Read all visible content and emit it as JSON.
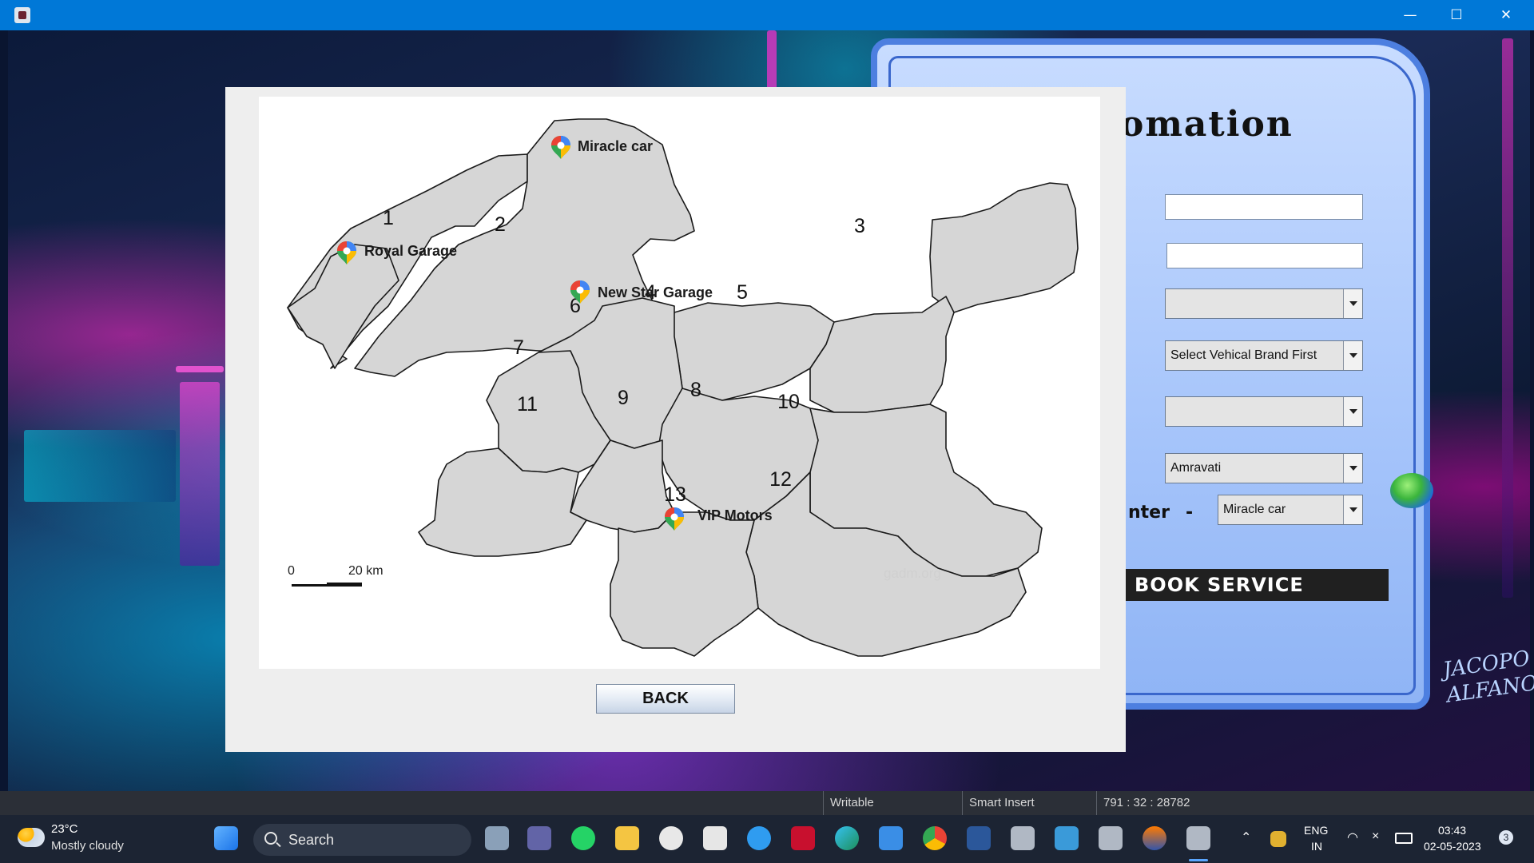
{
  "window": {
    "minimize_glyph": "—",
    "maximize_glyph": "☐",
    "close_glyph": "✕"
  },
  "background_app": {
    "title_fragment": "omation",
    "combo_brand": "Select Vehical Brand First",
    "combo_city": "Amravati",
    "center_label_fragment": "nter",
    "center_dash": "-",
    "combo_center": "Miracle car",
    "book_button": "BOOK SERVICE",
    "signature_line1": "JACOPO",
    "signature_line2": "ALFANO"
  },
  "map_dialog": {
    "districts": [
      {
        "number": "1"
      },
      {
        "number": "2"
      },
      {
        "number": "3"
      },
      {
        "number": "4"
      },
      {
        "number": "5"
      },
      {
        "number": "6"
      },
      {
        "number": "7"
      },
      {
        "number": "8"
      },
      {
        "number": "9"
      },
      {
        "number": "10"
      },
      {
        "number": "11"
      },
      {
        "number": "12"
      },
      {
        "number": "13"
      }
    ],
    "garages": [
      {
        "name": "Miracle car"
      },
      {
        "name": "Royal Garage"
      },
      {
        "name": "New Star Garage"
      },
      {
        "name": "VIP Motors"
      }
    ],
    "scale_start": "0",
    "scale_end": "20 km",
    "watermark": "gadm.org",
    "back_button": "BACK"
  },
  "statusbar": {
    "mode": "Writable",
    "insert_mode": "Smart Insert",
    "position": "791 : 32 : 28782"
  },
  "taskbar": {
    "weather_temp": "23°C",
    "weather_desc": "Mostly cloudy",
    "search_label": "Search",
    "language": "ENG",
    "region": "IN",
    "time": "03:43",
    "date": "02-05-2023",
    "notification_count": "3"
  },
  "colors": {
    "titlebar": "#0078d7",
    "taskbar": "#1c2433",
    "district_fill": "#d6d6d6",
    "panel_border": "#4d7fe0"
  }
}
